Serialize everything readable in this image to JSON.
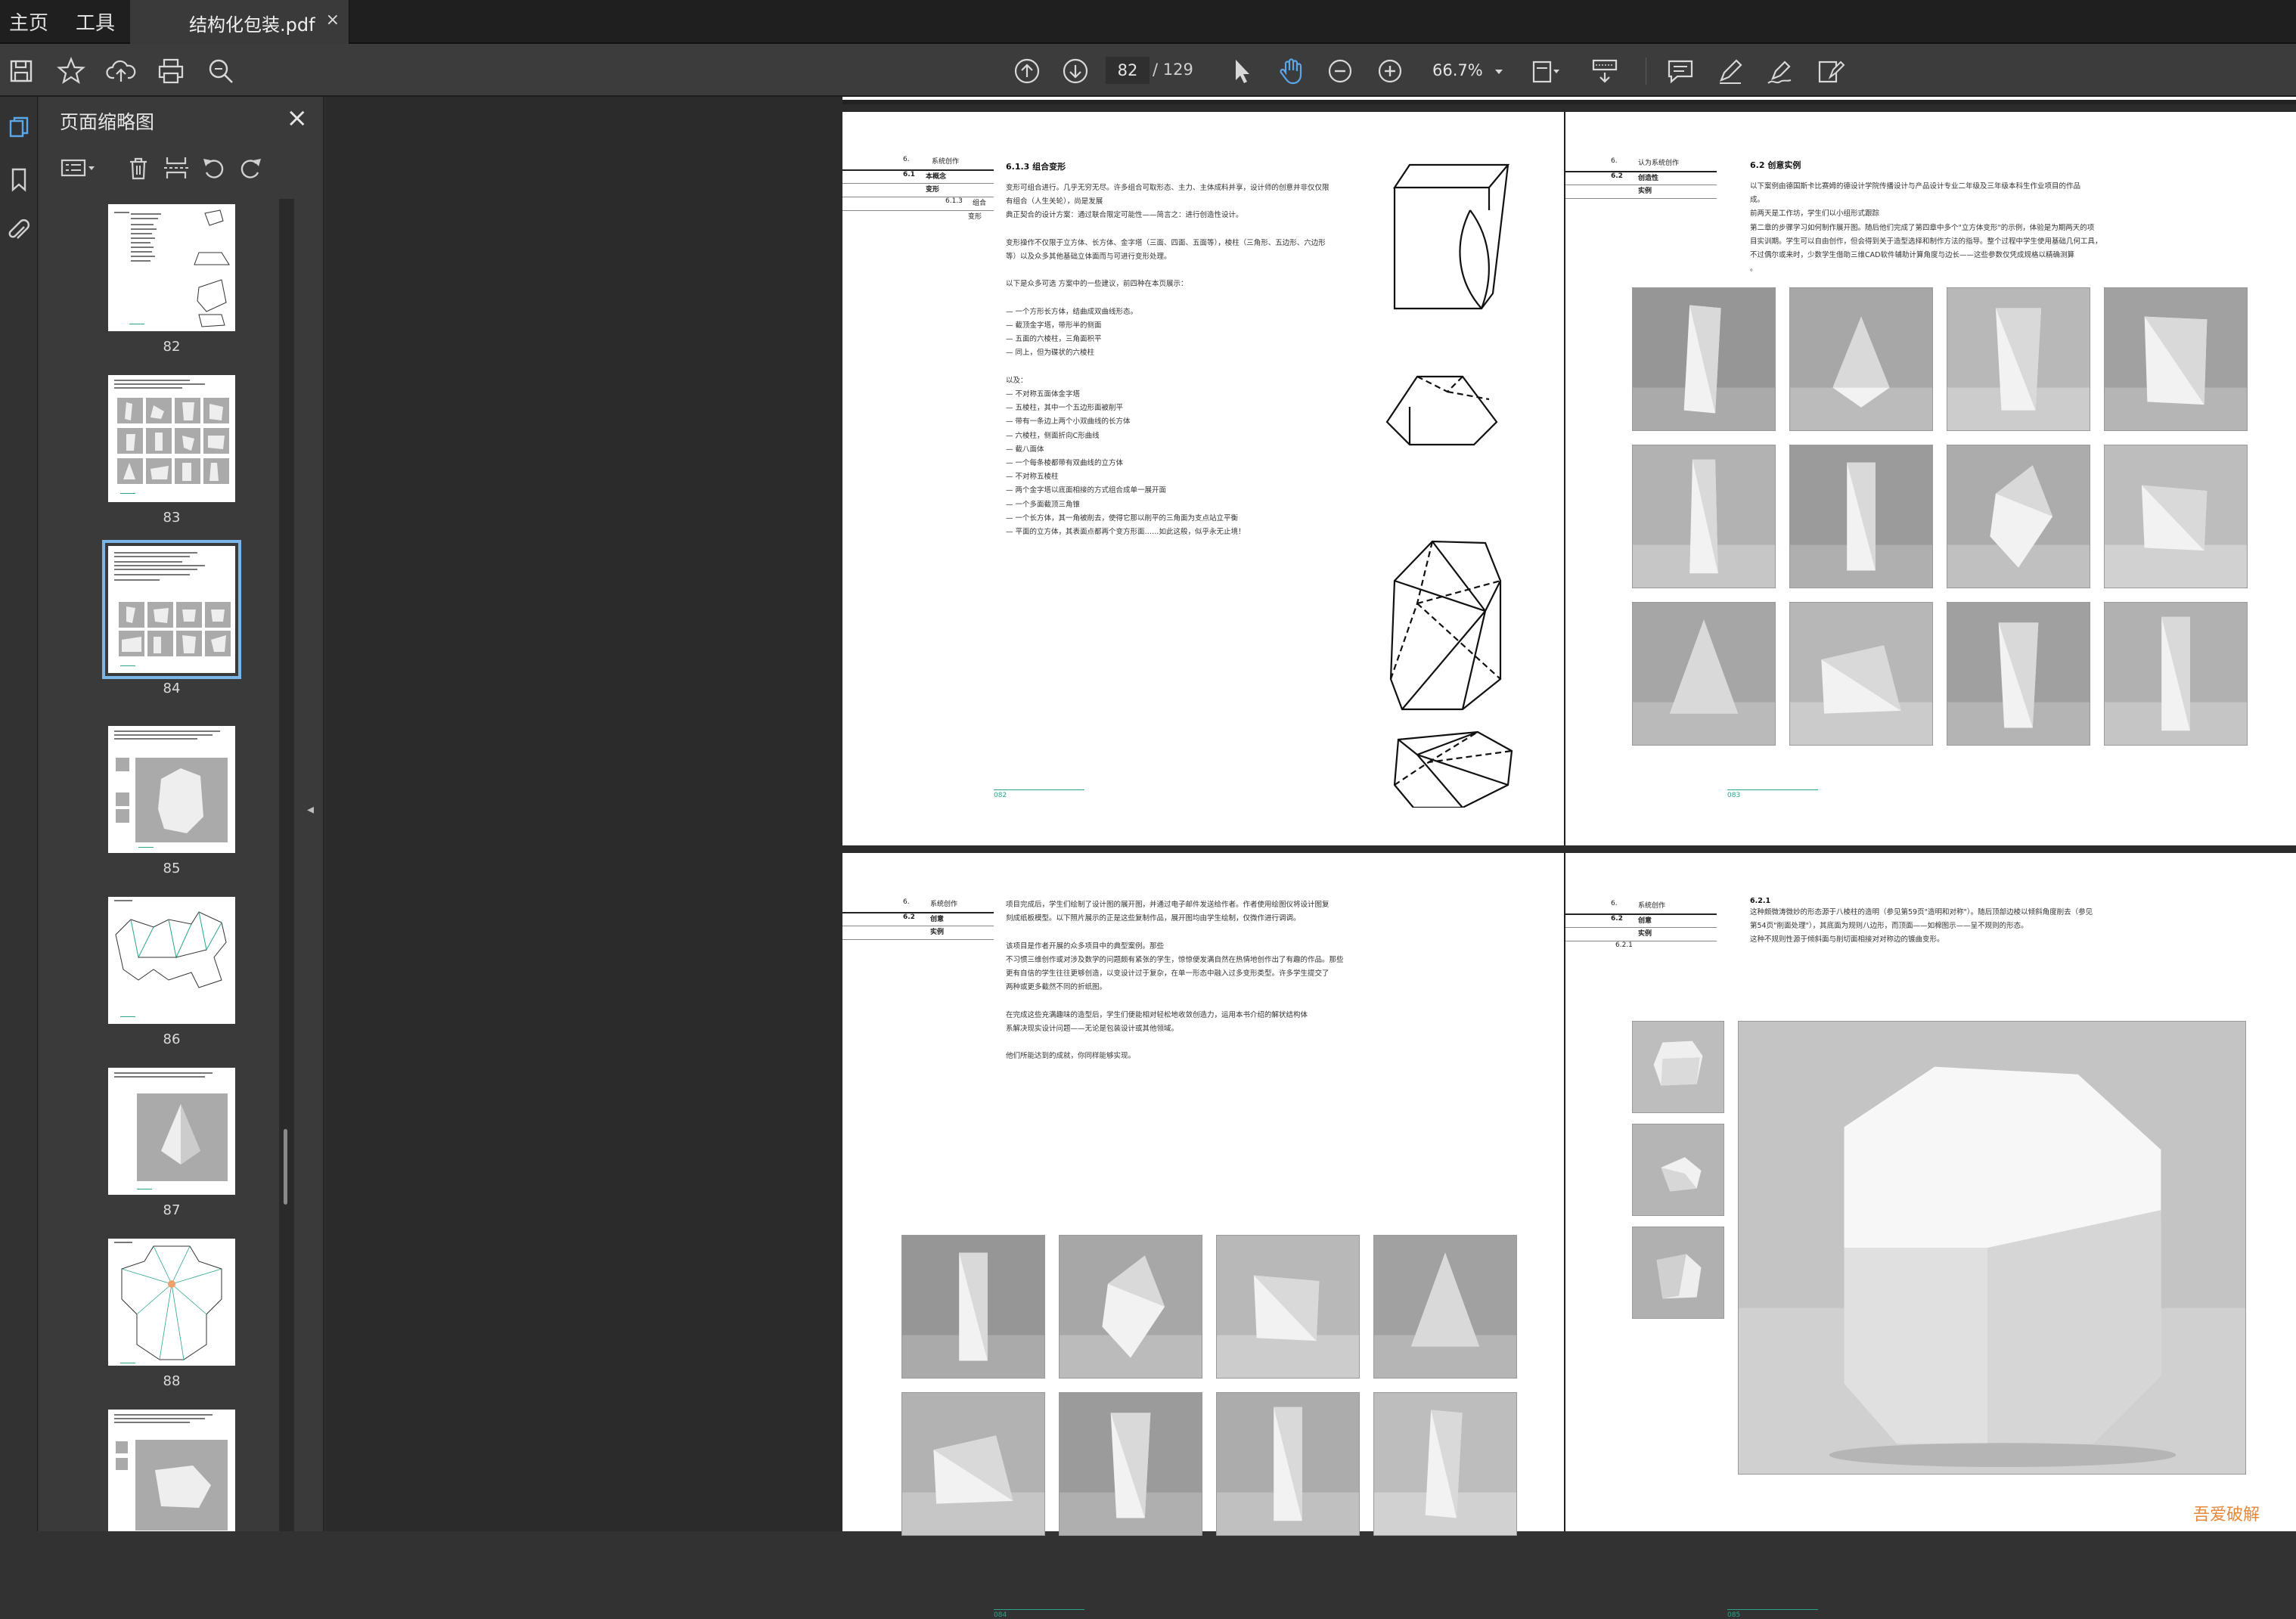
{
  "tabs": {
    "home": "主页",
    "tools": "工具",
    "document_title": "结构化包装.pdf",
    "close": "×"
  },
  "toolbar": {
    "current_page": "82",
    "page_total": "/ 129",
    "zoom": "66.7%"
  },
  "panel": {
    "title": "页面缩略图",
    "close": "×"
  },
  "thumbnails": [
    {
      "label": "82",
      "selected": false
    },
    {
      "label": "83",
      "selected": false
    },
    {
      "label": "84",
      "selected": true
    },
    {
      "label": "85",
      "selected": false
    },
    {
      "label": "86",
      "selected": false
    },
    {
      "label": "87",
      "selected": false
    },
    {
      "label": "88",
      "selected": false
    }
  ],
  "pages": {
    "p82": {
      "sidebar": {
        "r1a": "6.",
        "r1b": "系统创作",
        "r2a": "6.1",
        "r2b": "本概念",
        "r3b": "变形",
        "r4a": "6.1.3",
        "r4b": "组合"
      },
      "heading": "6.1.3  组合变形",
      "paragraphs": [
        "变形可组合进行。几乎无穷无尽。许多组合可取形态、主力、主体成料并享，设计师的创意并非仅仅限",
        "有组合（人生关轮），尚是发展",
        "典正契合的设计方案：通过联合限定可能性——简言之：进行创造性设计。",
        "",
        "变形操作不仅限于立方体、长方体、金字塔（三面、四面、五面等），棱柱（三角形、五边形、六边形",
        "等）以及众多其他基础立体面而与可进行变形处理。",
        "",
        "以下是众多可选 方案中的一些建议，前四种在本页展示：",
        "",
        "— 一个方形长方体，结曲成双曲线形态。",
        "— 截顶金字塔，带形半的侧面",
        "— 五面的六棱柱，三角面积平",
        "— 同上，但为碟状的六棱柱",
        "",
        "以及：",
        "— 不对称五面体金字塔",
        "— 五棱柱，其中一个五边形面被削平",
        "— 带有一条边上两个小双曲线的长方体",
        "— 六棱柱，侧面折向C形曲线",
        "— 截八面体",
        "— 一个每条棱都带有双曲线的立方体",
        "— 不对称五棱柱",
        "— 两个金字塔以底面相接的方式组合成单一展开面",
        "— 一个多面截顶三角锥",
        "— 一个长方体，其一角被削去，使得它那以削平的三角面为支点站立平衡",
        "— 平面的立方体，其表面点都再个变方形面……如此这般，似乎永无止境！"
      ],
      "footer": "082"
    },
    "p83": {
      "sidebar": {
        "r1a": "6.",
        "r1b": "认为系统创作",
        "r2a": "6.2",
        "r2b": "创造性",
        "r3b": "实例"
      },
      "heading": "6.2  创意实例",
      "paragraphs": [
        "以下案例由德国斯卡比赛姆的德设计学院传播设计与产品设计专业二年级及三年级本科生作业项目的作品",
        "成。",
        "前两天是工作坊，学生们以小组形式跟踪",
        "第二章的步骤学习如何制作展开图。随后他们完成了第四章中多个\"立方体变形\"的示例，体验是为期两天的项",
        "目实训期。学生可以自由创作，但会得到关于造型选择和制作方法的指导。整个过程中学生使用基础几何工具，",
        "不过偶尔或来时，少数学生借助三维CAD软件辅助计算角度与边长——这些参数仅凭成规格以精确测算",
        "。"
      ],
      "footer": "083"
    },
    "p84": {
      "sidebar": {
        "r1a": "6.",
        "r1b": "系统创作",
        "r2a": "6.2",
        "r2b": "创意",
        "r3b": "实例"
      },
      "paragraphs": [
        "项目完成后，学生们绘制了设计图的展开图，并通过电子邮件发送给作者。作者使用绘图仪将设计图复",
        "刻成纸板模型。以下照片展示的正是这些复制作品，展开图均由学生绘制，仅微作进行调调。",
        "",
        "该项目是作者开展的众多项目中的典型案例。那些",
        "不习惯三维创作或对涉及数学的问题颇有紧张的学生，惊惊便发满自然在热情地创作出了有趣的作品。那些",
        "更有自信的学生往往更够创造，以变设计过于复杂，在单一形态中融入过多变形类型。许多学生提交了",
        "两种或更多截然不同的折纸图。",
        "",
        "在完成这些充满趣味的造型后，学生们便能相对轻松地收敛创造力，运用本书介绍的解状结构体",
        "系解决现实设计问题——无论是包装设计或其他领域。",
        "",
        "他们所能达到的成就，你同样能够实现。"
      ],
      "footer": "084"
    },
    "p85": {
      "sidebar": {
        "r1a": "6.",
        "r1b": "系统创作",
        "r2a": "6.2",
        "r2b": "创意",
        "r3b": "实例",
        "r4a": "6.2.1"
      },
      "heading": "6.2.1",
      "paragraphs": [
        "这种颇微涛微妙的形态源于八棱柱的造明（参见第59页\"造明和对称\"）。随后顶部边棱以倾斜角度削去（参见",
        "第54页\"削面处理\"），其底面为规则八边形，而顶面——如棉图示——呈不规则的形态。",
        "这种不规则性源于倾斜面与削切面相接对对称边的镀曲变形。"
      ],
      "footer": "085"
    }
  },
  "watermark": "吾爱破解"
}
